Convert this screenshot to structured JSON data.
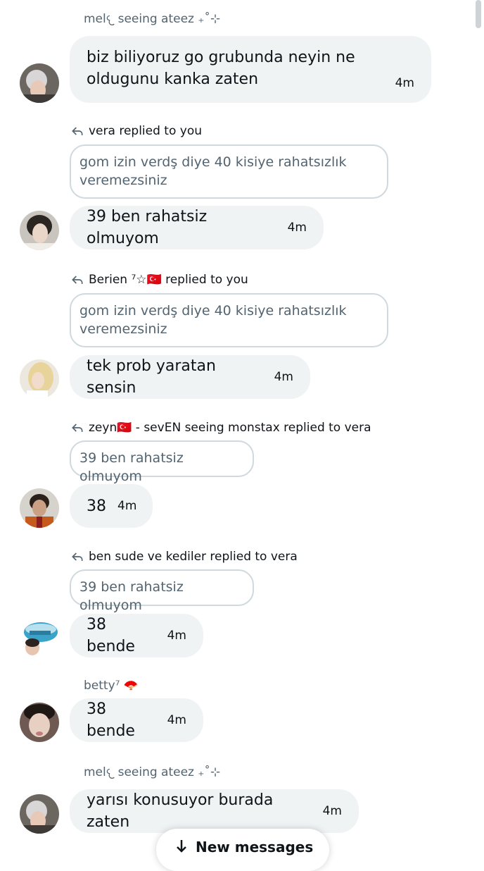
{
  "messages": [
    {
      "sender": "mel𐔌 seeing ateez ₊˚⊹",
      "text": "biz biliyoruz go grubunda neyin ne oldugunu kanka zaten",
      "time": "4m"
    },
    {
      "reply": "vera replied to you",
      "quote": "gom izin verdş diye 40 kisiye rahatsızlık veremezsiniz",
      "text": "39 ben rahatsiz olmuyom",
      "time": "4m"
    },
    {
      "reply": "Berien ⁷☆🇹🇷 replied to you",
      "quote": "gom izin verdş diye 40 kisiye rahatsızlık veremezsiniz",
      "text": "tek prob yaratan sensin",
      "time": "4m"
    },
    {
      "reply": "zeyn🇹🇷 - sevEN seeing monstax replied to vera",
      "quote": "39 ben rahatsiz olmuyom",
      "text": "38",
      "time": "4m"
    },
    {
      "reply": "ben sude ve kediler replied to vera",
      "quote": "39 ben rahatsiz olmuyom",
      "text": "38 bende",
      "time": "4m"
    },
    {
      "sender": "betty⁷ 🪭",
      "text": "38 bende",
      "time": "4m"
    },
    {
      "sender": "mel𐔌 seeing ateez ₊˚⊹",
      "text": "yarısı konusuyor burada zaten",
      "time": "4m"
    }
  ],
  "bottom_bar": {
    "label": "New messages"
  },
  "colors": {
    "bubble": "#eff3f4",
    "muted": "#536471",
    "border": "#cfd9de"
  }
}
